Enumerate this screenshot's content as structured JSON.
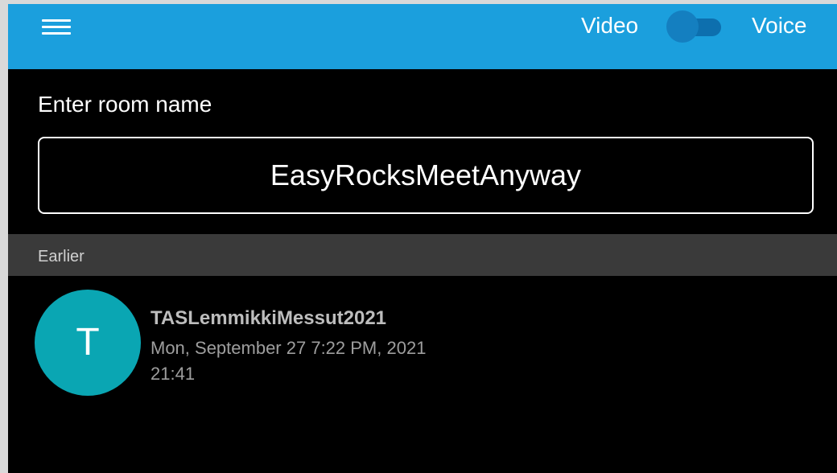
{
  "header": {
    "menu_icon": "hamburger-menu-icon",
    "video_label": "Video",
    "voice_label": "Voice",
    "toggle_state": "video",
    "background_color": "#1b9fdd"
  },
  "room": {
    "label": "Enter room name",
    "value": "EasyRocksMeetAnyway"
  },
  "recent": {
    "section_label": "Earlier",
    "items": [
      {
        "avatar_letter": "T",
        "avatar_color": "#0aa6b3",
        "name": "TASLemmikkiMessut2021",
        "date": "Mon, September 27 7:22 PM, 2021",
        "duration": "21:41"
      }
    ]
  }
}
